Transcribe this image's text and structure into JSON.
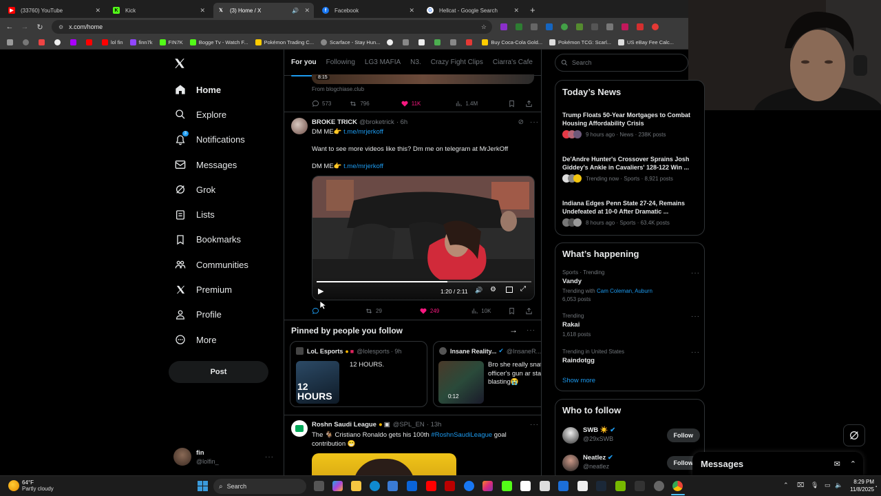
{
  "browser": {
    "tabs": [
      {
        "title": "(33760) YouTube",
        "icon": "youtube-icon",
        "color": "#ff0000"
      },
      {
        "title": "Kick",
        "icon": "kick-icon",
        "color": "#53fc18"
      },
      {
        "title": "(3) Home / X",
        "icon": "x-icon",
        "color": "#ffffff"
      },
      {
        "title": "Facebook",
        "icon": "facebook-icon",
        "color": "#1877f2"
      },
      {
        "title": "Hellcat - Google Search",
        "icon": "google-icon",
        "color": "#4285f4"
      }
    ],
    "url": "x.com/home",
    "bookmarks": [
      "lol fin",
      "finn7k",
      "FIN7K",
      "Bogge Tv - Watch F...",
      "Pokémon Trading C...",
      "Scarface - Stay Hun...",
      "Buy Coca-Cola Gold...",
      "Pokémon TCG: Scarl...",
      "US eBay Fee Calc..."
    ]
  },
  "nav": {
    "items": [
      {
        "label": "Home",
        "icon": "home-icon"
      },
      {
        "label": "Explore",
        "icon": "search-icon"
      },
      {
        "label": "Notifications",
        "icon": "bell-icon"
      },
      {
        "label": "Messages",
        "icon": "envelope-icon"
      },
      {
        "label": "Grok",
        "icon": "grok-icon"
      },
      {
        "label": "Lists",
        "icon": "list-icon"
      },
      {
        "label": "Bookmarks",
        "icon": "bookmark-icon"
      },
      {
        "label": "Communities",
        "icon": "people-icon"
      },
      {
        "label": "Premium",
        "icon": "x-icon"
      },
      {
        "label": "Profile",
        "icon": "person-icon"
      },
      {
        "label": "More",
        "icon": "more-circle-icon"
      }
    ],
    "notification_badge": "3",
    "post_label": "Post",
    "user": {
      "name": "fin",
      "handle": "@lolfin_"
    }
  },
  "feed": {
    "tabs": [
      "For you",
      "Following",
      "LG3 MAFIA",
      "N3.",
      "Crazy Fight Clips",
      "Ciarra's Cafe"
    ],
    "prev_post": {
      "source": "From blogchiase.club",
      "badge": "8:15",
      "replies": "573",
      "reposts": "796",
      "likes": "11K",
      "views": "1.4M"
    },
    "tweet": {
      "name": "BROKE TRICK",
      "handle": "@broketrick",
      "time": "· 6h",
      "line1": "DM ME👉",
      "link1": "t.me/mrjerkoff",
      "body": "Want to see more videos like this? Dm me on telegram at MrJerkOff",
      "line3": "DM ME👉",
      "link2": "t.me/mrjerkoff",
      "video_time": "1:20 / 2:11",
      "progress": 0.61,
      "reposts": "29",
      "likes": "249",
      "views": "10K"
    },
    "pinned": {
      "title": "Pinned by people you follow",
      "cards": [
        {
          "name": "LoL Esports",
          "handle": "@lolesports",
          "time": "· 9h",
          "text": "12 HOURS.",
          "thumb_text": "12 HOURS"
        },
        {
          "name": "Insane Reality...",
          "handle": "@InsaneR...",
          "text": "Bro she really snat the officer's gun ar started blasting😭",
          "duration": "0:12"
        }
      ]
    },
    "tweet2": {
      "name": "Roshn Saudi League",
      "handle": "@SPL_EN",
      "time": "· 13h",
      "text_a": "The 🐐 Cristiano Ronaldo gets his 100th ",
      "hashtag": "#RoshnSaudiLeague",
      "text_b": " goal contribution 😁"
    }
  },
  "search": {
    "placeholder": "Search"
  },
  "news": {
    "title": "Today’s News",
    "items": [
      {
        "headline": "Trump Floats 50-Year Mortgages to Combat Housing Affordability Crisis",
        "meta": "9 hours ago · News · 238K posts"
      },
      {
        "headline": "De'Andre Hunter's Crossover Sprains Josh Giddey's Ankle in Cavaliers' 128-122 Win ...",
        "meta": "Trending now · Sports · 8,921 posts"
      },
      {
        "headline": "Indiana Edges Penn State 27-24, Remains Undefeated at 10-0 After Dramatic ...",
        "meta": "8 hours ago · Sports · 63.4K posts"
      }
    ]
  },
  "happening": {
    "title": "What’s happening",
    "items": [
      {
        "context": "Sports · Trending",
        "topic": "Vandy",
        "with_label": "Trending with",
        "with_links": "Cam Coleman, Auburn",
        "posts": "6,053 posts"
      },
      {
        "context": "Trending",
        "topic": "Rakai",
        "posts": "1,618 posts"
      },
      {
        "context": "Trending in United States",
        "topic": "Raindotgg",
        "posts": ""
      }
    ],
    "show_more": "Show more"
  },
  "who_to_follow": {
    "title": "Who to follow",
    "users": [
      {
        "name": "SWB ☀️",
        "handle": "@29xSWB",
        "button": "Follow"
      },
      {
        "name": "Neatlez",
        "handle": "@neatlez",
        "button": "Follow"
      }
    ]
  },
  "messages_drawer": {
    "title": "Messages"
  },
  "taskbar": {
    "weather_temp": "64°F",
    "weather_desc": "Partly cloudy",
    "search": "Search",
    "time": "8:29 PM",
    "date": "11/8/2025"
  },
  "colors": {
    "accent": "#1d9bf0",
    "like": "#f91880",
    "bg": "#000000",
    "border": "#2f3336"
  }
}
